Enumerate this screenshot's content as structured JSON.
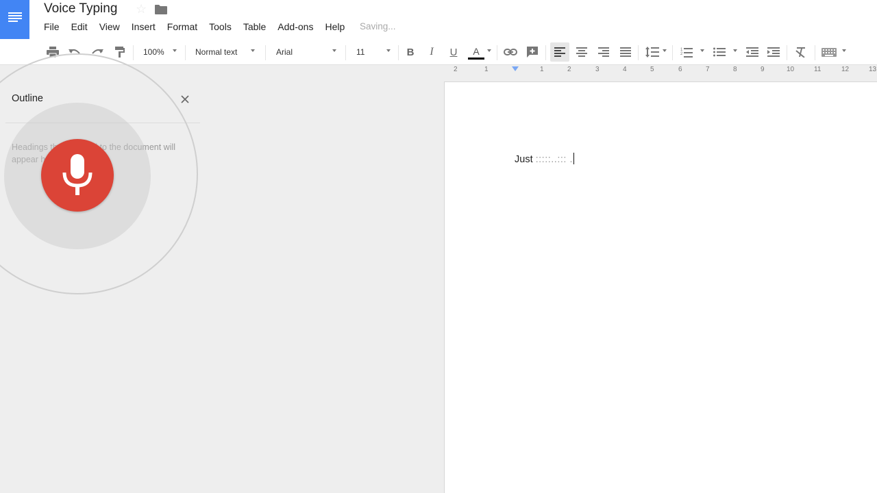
{
  "app": {
    "title": "Voice Typing",
    "status": "Saving..."
  },
  "menu": [
    "File",
    "Edit",
    "View",
    "Insert",
    "Format",
    "Tools",
    "Table",
    "Add-ons",
    "Help"
  ],
  "toolbar": {
    "zoom": "100%",
    "style": "Normal text",
    "font": "Arial",
    "size": "11",
    "text_color": "#000000"
  },
  "ruler": {
    "ticks": [
      "2",
      "1",
      "1",
      "2",
      "3",
      "4",
      "5",
      "6",
      "7",
      "8",
      "9",
      "10",
      "11",
      "12",
      "13"
    ]
  },
  "outline": {
    "title": "Outline",
    "hint": "Headings that you add to the document will appear here."
  },
  "voice": {
    "mic_color": "#db4437"
  },
  "document": {
    "text": "Just",
    "tail": ":::::..::: ."
  }
}
